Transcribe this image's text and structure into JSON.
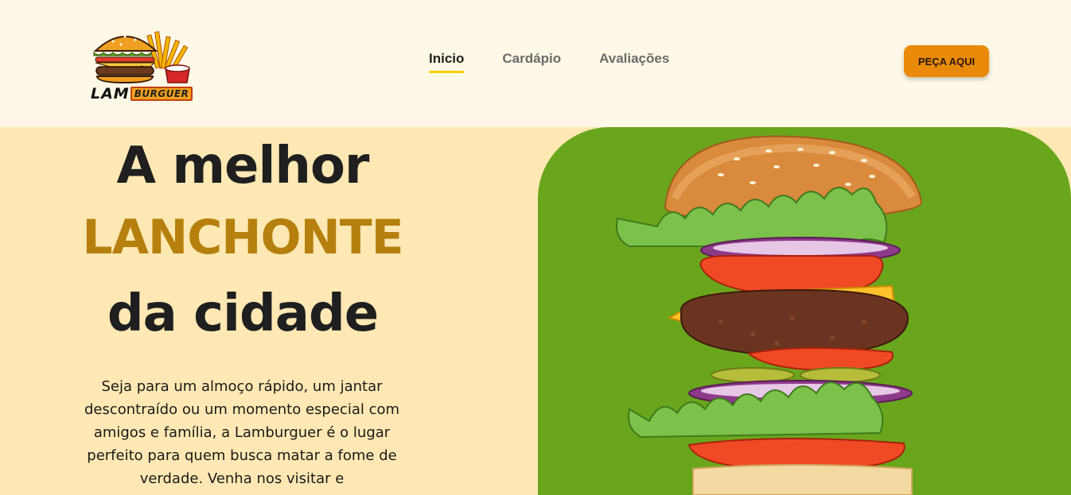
{
  "brand": {
    "logo_main": "LAM",
    "logo_accent": "BURGUER"
  },
  "nav": {
    "items": [
      {
        "label": "Inicio",
        "active": true
      },
      {
        "label": "Cardápio",
        "active": false
      },
      {
        "label": "Avaliações",
        "active": false
      }
    ]
  },
  "header": {
    "cta_label": "PEÇA AQUI"
  },
  "hero": {
    "line1": "A melhor",
    "line2": "LANCHONTE",
    "line3": "da cidade",
    "description": "Seja para um almoço rápido, um jantar descontraído ou um momento especial com amigos e família, a Lamburguer é o lugar perfeito para quem busca matar a fome de verdade. Venha nos visitar e"
  },
  "colors": {
    "page_bg": "#fff8e6",
    "hero_bg": "#ffe8b3",
    "accent_gold": "#b5800d",
    "cta_orange": "#e98a0a",
    "panel_green": "#6aa61c",
    "nav_underline": "#f5d000"
  },
  "icons": {
    "logo": "burger-fries-logo-icon",
    "hero_image": "stacked-burger-image"
  }
}
